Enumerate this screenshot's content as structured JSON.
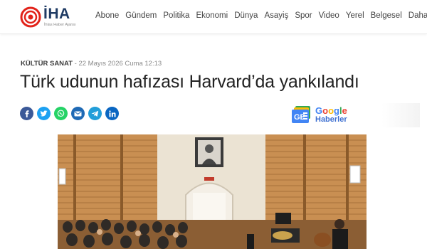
{
  "brand": {
    "name": "İHA",
    "tagline": "İhlas Haber Ajansı",
    "primary_color": "#1f3b64",
    "accent_color": "#e2231a"
  },
  "nav": {
    "items": [
      "Abone",
      "Gündem",
      "Politika",
      "Ekonomi",
      "Dünya",
      "Asayiş",
      "Spor",
      "Video",
      "Yerel",
      "Belgesel"
    ],
    "more_label": "Daha"
  },
  "article": {
    "category": "KÜLTÜR SANAT",
    "date": "- 22 Mayıs 2026 Cuma 12:13",
    "title": "Türk udunun hafızası Harvard’da yankılandı"
  },
  "share": {
    "buttons": [
      "facebook-icon",
      "twitter-icon",
      "whatsapp-icon",
      "email-icon",
      "telegram-icon",
      "linkedin-icon"
    ]
  },
  "google_news": {
    "line1": "Google",
    "line2": "Haberler"
  }
}
